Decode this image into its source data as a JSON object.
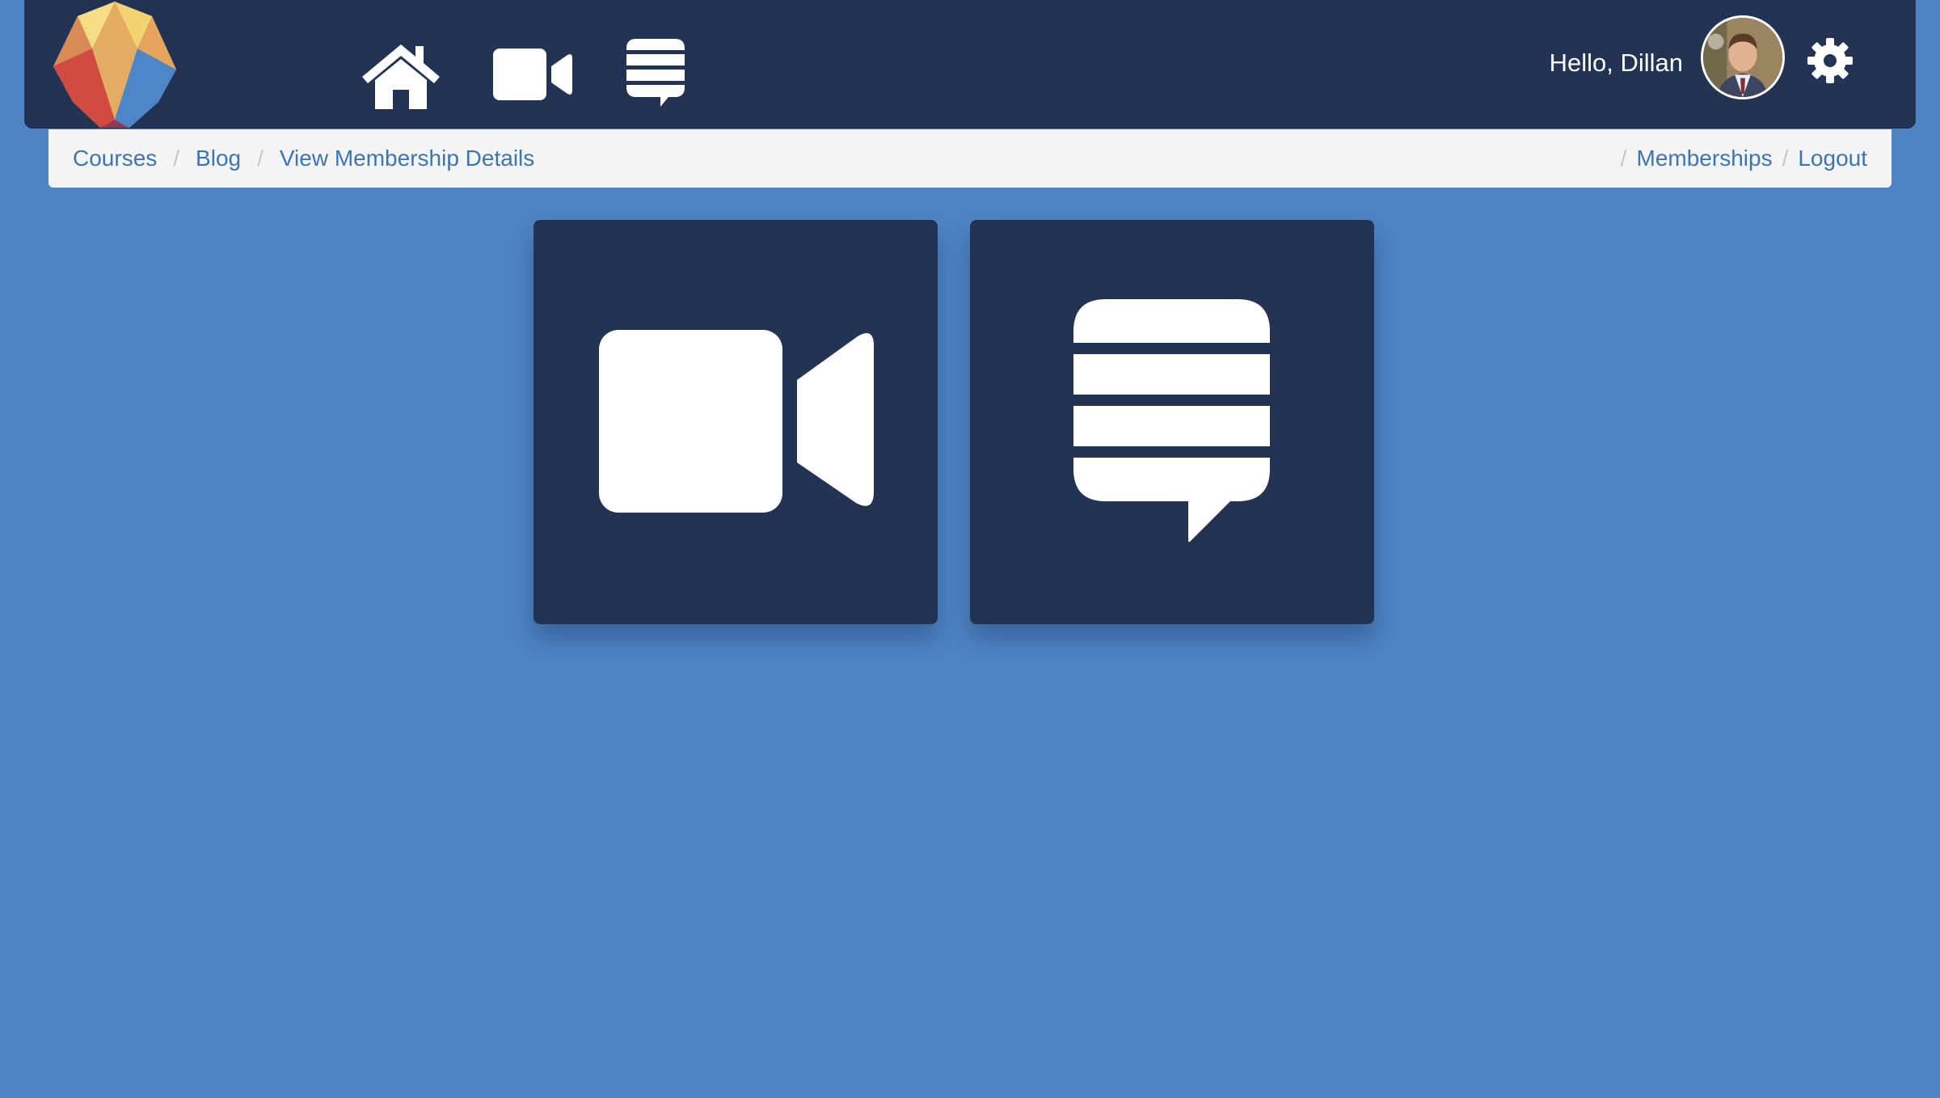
{
  "header": {
    "greeting": "Hello, Dillan",
    "logo": "gem-logo",
    "nav": [
      {
        "icon": "home-icon"
      },
      {
        "icon": "video-camera-icon"
      },
      {
        "icon": "chat-lines-icon"
      }
    ],
    "avatar": "user-avatar",
    "settings_icon": "gear-icon"
  },
  "breadcrumb": {
    "left": [
      "Courses",
      "Blog",
      "View Membership Details"
    ],
    "right": [
      "Memberships",
      "Logout"
    ]
  },
  "tiles": [
    {
      "icon": "video-camera-icon"
    },
    {
      "icon": "chat-lines-icon"
    }
  ],
  "colors": {
    "background": "#4e84c5",
    "navy": "#233354",
    "link": "#3c76b2",
    "breadcrumb_bg": "#f4f4f4"
  }
}
